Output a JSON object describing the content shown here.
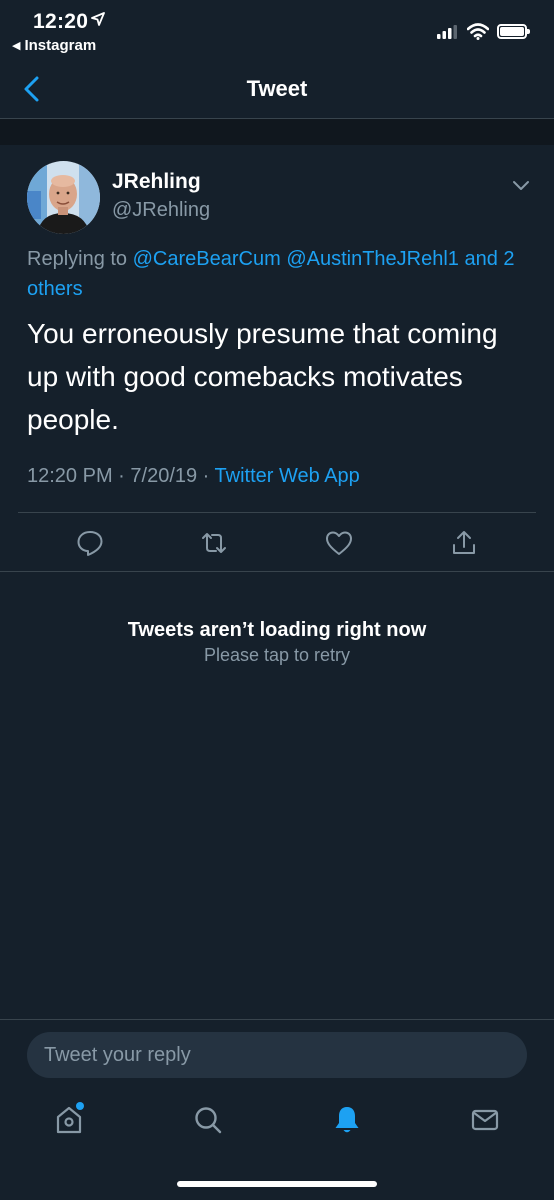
{
  "status_bar": {
    "time": "12:20",
    "back_app": "Instagram"
  },
  "nav": {
    "title": "Tweet"
  },
  "tweet": {
    "author_name": "JRehling",
    "author_handle": "@JRehling",
    "replying_prefix": "Replying to",
    "replying_user1": "@CareBearCum",
    "replying_user2": "@AustinTheJRehl1",
    "replying_and": "and",
    "replying_others": "2 others",
    "text": "You erroneously presume that coming up with good comebacks motivates people.",
    "time": "12:20 PM",
    "date": "7/20/19",
    "source": "Twitter Web App"
  },
  "error": {
    "title": "Tweets aren’t loading right now",
    "subtitle": "Please tap to retry"
  },
  "composer": {
    "placeholder": "Tweet your reply"
  },
  "colors": {
    "background": "#15202b",
    "accent": "#1da1f2",
    "secondary_text": "#8899a6",
    "divider": "#38444d"
  },
  "tabs": [
    {
      "icon": "home-icon",
      "has_badge": true
    },
    {
      "icon": "search-icon"
    },
    {
      "icon": "bell-icon",
      "active": true
    },
    {
      "icon": "mail-icon"
    }
  ]
}
